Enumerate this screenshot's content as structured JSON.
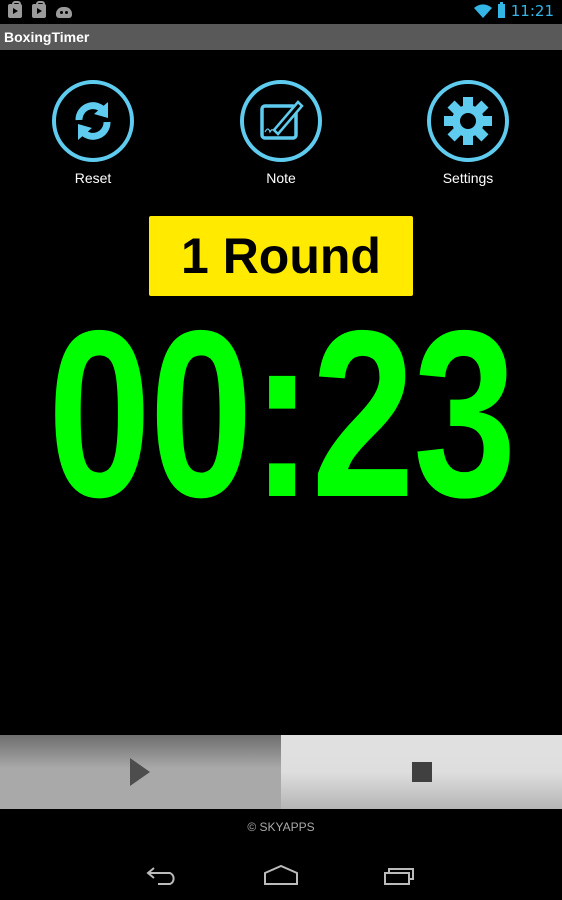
{
  "status_bar": {
    "notification_icons": [
      "play-store-icon",
      "play-store-icon",
      "android-icon"
    ],
    "wifi_icon": "wifi-icon",
    "battery_icon": "battery-charging-icon",
    "time": "11:21"
  },
  "action_bar": {
    "title": "BoxingTimer"
  },
  "toolbar": {
    "items": [
      {
        "label": "Reset",
        "icon": "refresh-icon"
      },
      {
        "label": "Note",
        "icon": "note-edit-icon"
      },
      {
        "label": "Settings",
        "icon": "gear-icon"
      }
    ]
  },
  "round": {
    "label": "1 Round"
  },
  "timer": {
    "display": "00:23"
  },
  "controls": {
    "play_icon": "play-icon",
    "stop_icon": "stop-icon"
  },
  "footer": {
    "copyright": "© SKYAPPS"
  },
  "nav_bar": {
    "buttons": [
      "back",
      "home",
      "recent-apps"
    ]
  },
  "colors": {
    "accent": "#5fcbee",
    "timer": "#00ff00",
    "round_badge": "#ffea00",
    "status_clock": "#33b5e5",
    "action_bar": "#595959"
  }
}
